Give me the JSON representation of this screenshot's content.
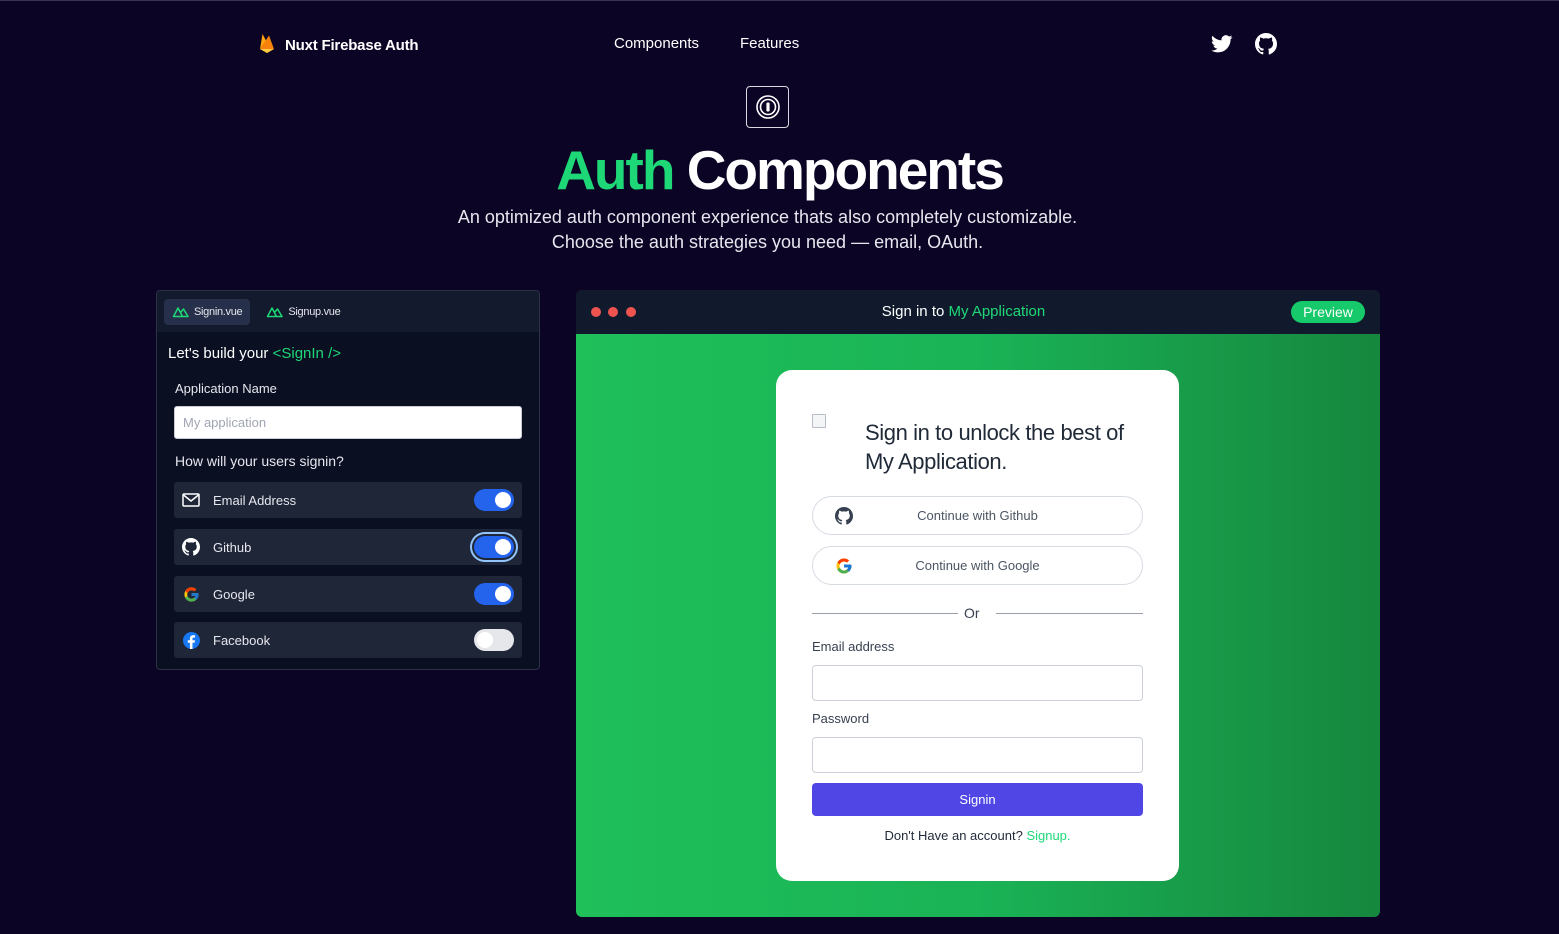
{
  "nav": {
    "brand": "Nuxt Firebase Auth",
    "links": [
      "Components",
      "Features"
    ],
    "social": [
      "twitter-icon",
      "github-icon"
    ]
  },
  "hero": {
    "title_accent": "Auth",
    "title_rest": "Components",
    "subtitle_line1": "An optimized auth component experience thats also completely customizable.",
    "subtitle_line2": "Choose the auth strategies you need — email, OAuth."
  },
  "builder": {
    "tabs": [
      {
        "label": "Signin.vue",
        "active": true
      },
      {
        "label": "Signup.vue",
        "active": false
      }
    ],
    "heading_prefix": "Let's build your",
    "heading_code": "<SignIn />",
    "app_name_label": "Application Name",
    "app_name_placeholder": "My application",
    "app_name_value": "",
    "signin_question": "How will your users signin?",
    "providers": [
      {
        "label": "Email Address",
        "icon": "mail-icon",
        "enabled": true
      },
      {
        "label": "Github",
        "icon": "github-icon",
        "enabled": true
      },
      {
        "label": "Google",
        "icon": "google-icon",
        "enabled": true
      },
      {
        "label": "Facebook",
        "icon": "facebook-icon",
        "enabled": false
      }
    ]
  },
  "preview": {
    "title_prefix": "Sign in to",
    "title_app": "My Application",
    "badge": "Preview",
    "card": {
      "title": "Sign in to unlock the best of My Application.",
      "github_button": "Continue with Github",
      "google_button": "Continue with Google",
      "divider": "Or",
      "email_label": "Email address",
      "password_label": "Password",
      "submit": "Signin",
      "footer_text": "Don't Have an account?",
      "footer_link": "Signup"
    }
  },
  "colors": {
    "background": "#0c0425",
    "accent_green": "#1ed877",
    "toggle_on": "#2463eb",
    "signin_button": "#4f46e5"
  }
}
